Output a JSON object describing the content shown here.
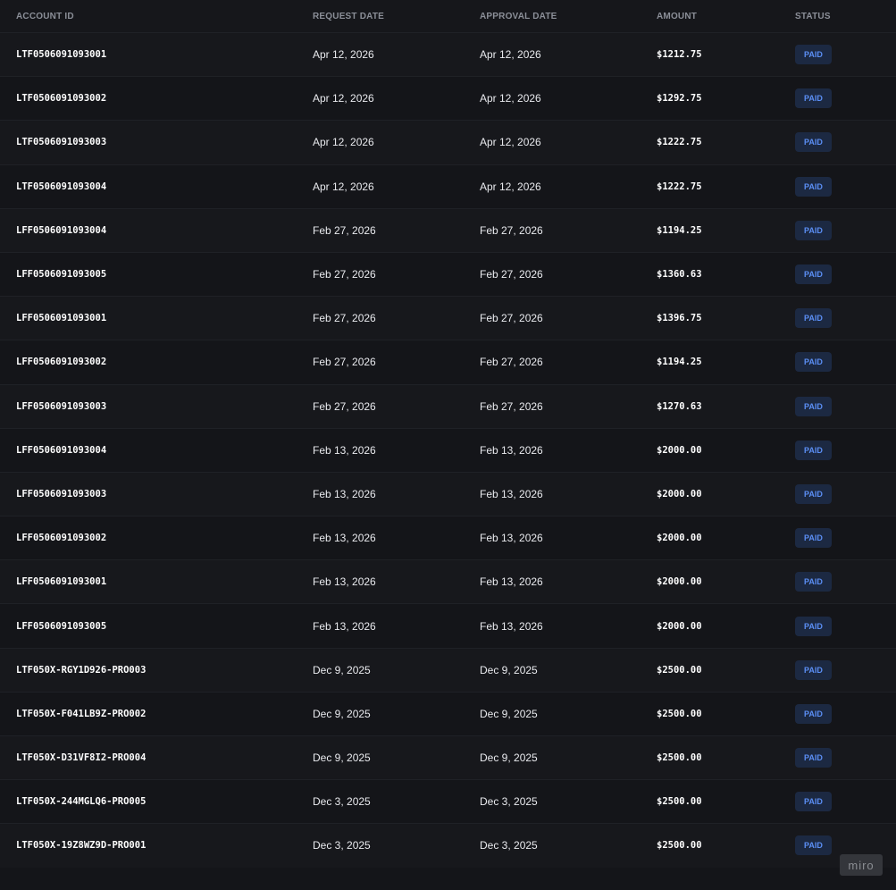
{
  "headers": {
    "account_id": "ACCOUNT ID",
    "request_date": "REQUEST DATE",
    "approval_date": "APPROVAL DATE",
    "amount": "AMOUNT",
    "status": "STATUS"
  },
  "rows": [
    {
      "account_id": "LTF0506091093001",
      "request_date": "Apr 12, 2026",
      "approval_date": "Apr 12, 2026",
      "amount": "$1212.75",
      "status": "PAID"
    },
    {
      "account_id": "LTF0506091093002",
      "request_date": "Apr 12, 2026",
      "approval_date": "Apr 12, 2026",
      "amount": "$1292.75",
      "status": "PAID"
    },
    {
      "account_id": "LTF0506091093003",
      "request_date": "Apr 12, 2026",
      "approval_date": "Apr 12, 2026",
      "amount": "$1222.75",
      "status": "PAID"
    },
    {
      "account_id": "LTF0506091093004",
      "request_date": "Apr 12, 2026",
      "approval_date": "Apr 12, 2026",
      "amount": "$1222.75",
      "status": "PAID"
    },
    {
      "account_id": "LFF0506091093004",
      "request_date": "Feb 27, 2026",
      "approval_date": "Feb 27, 2026",
      "amount": "$1194.25",
      "status": "PAID"
    },
    {
      "account_id": "LFF0506091093005",
      "request_date": "Feb 27, 2026",
      "approval_date": "Feb 27, 2026",
      "amount": "$1360.63",
      "status": "PAID"
    },
    {
      "account_id": "LFF0506091093001",
      "request_date": "Feb 27, 2026",
      "approval_date": "Feb 27, 2026",
      "amount": "$1396.75",
      "status": "PAID"
    },
    {
      "account_id": "LFF0506091093002",
      "request_date": "Feb 27, 2026",
      "approval_date": "Feb 27, 2026",
      "amount": "$1194.25",
      "status": "PAID"
    },
    {
      "account_id": "LFF0506091093003",
      "request_date": "Feb 27, 2026",
      "approval_date": "Feb 27, 2026",
      "amount": "$1270.63",
      "status": "PAID"
    },
    {
      "account_id": "LFF0506091093004",
      "request_date": "Feb 13, 2026",
      "approval_date": "Feb 13, 2026",
      "amount": "$2000.00",
      "status": "PAID"
    },
    {
      "account_id": "LFF0506091093003",
      "request_date": "Feb 13, 2026",
      "approval_date": "Feb 13, 2026",
      "amount": "$2000.00",
      "status": "PAID"
    },
    {
      "account_id": "LFF0506091093002",
      "request_date": "Feb 13, 2026",
      "approval_date": "Feb 13, 2026",
      "amount": "$2000.00",
      "status": "PAID"
    },
    {
      "account_id": "LFF0506091093001",
      "request_date": "Feb 13, 2026",
      "approval_date": "Feb 13, 2026",
      "amount": "$2000.00",
      "status": "PAID"
    },
    {
      "account_id": "LFF0506091093005",
      "request_date": "Feb 13, 2026",
      "approval_date": "Feb 13, 2026",
      "amount": "$2000.00",
      "status": "PAID"
    },
    {
      "account_id": "LTF050X-RGY1D926-PRO003",
      "request_date": "Dec 9, 2025",
      "approval_date": "Dec 9, 2025",
      "amount": "$2500.00",
      "status": "PAID"
    },
    {
      "account_id": "LTF050X-F041LB9Z-PRO002",
      "request_date": "Dec 9, 2025",
      "approval_date": "Dec 9, 2025",
      "amount": "$2500.00",
      "status": "PAID"
    },
    {
      "account_id": "LTF050X-D31VF8I2-PRO004",
      "request_date": "Dec 9, 2025",
      "approval_date": "Dec 9, 2025",
      "amount": "$2500.00",
      "status": "PAID"
    },
    {
      "account_id": "LTF050X-244MGLQ6-PRO005",
      "request_date": "Dec 3, 2025",
      "approval_date": "Dec 3, 2025",
      "amount": "$2500.00",
      "status": "PAID"
    },
    {
      "account_id": "LTF050X-19Z8WZ9D-PRO001",
      "request_date": "Dec 3, 2025",
      "approval_date": "Dec 3, 2025",
      "amount": "$2500.00",
      "status": "PAID"
    }
  ],
  "watermark": "miro",
  "colors": {
    "background": "#141519",
    "header_text": "#8b8f98",
    "badge_bg": "#1c2942",
    "badge_text": "#5b8ff5"
  }
}
